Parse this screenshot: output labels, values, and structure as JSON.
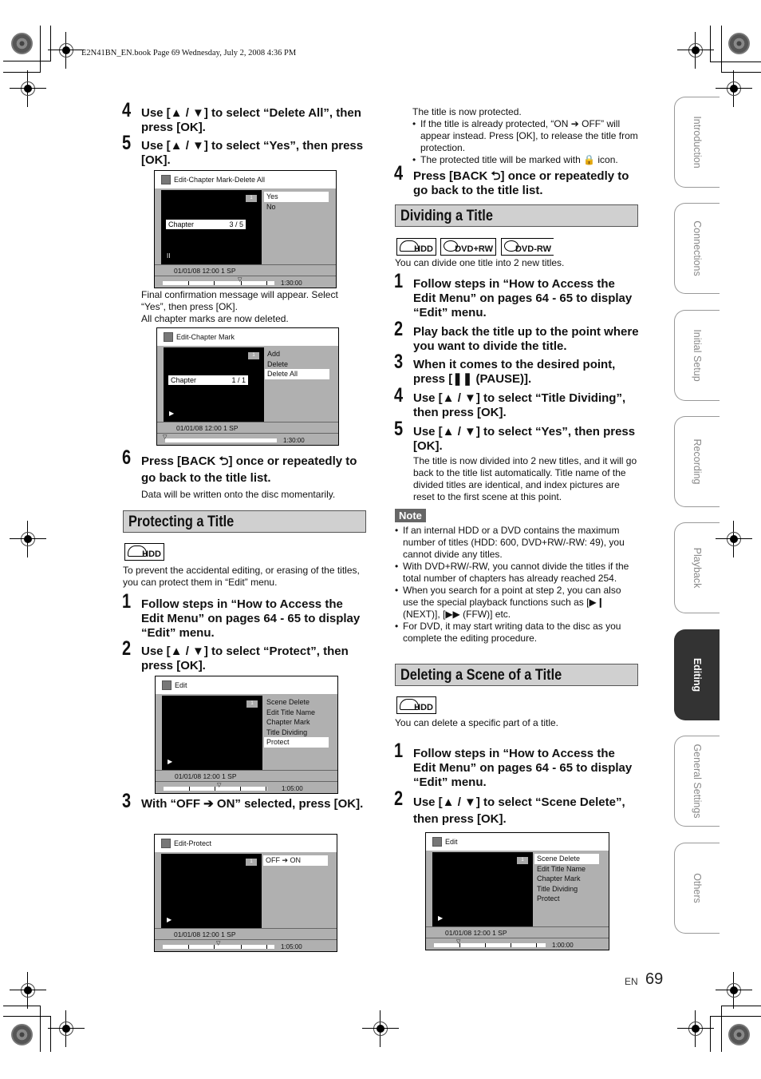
{
  "header": {
    "print_info": "E2N41BN_EN.book  Page 69  Wednesday, July 2, 2008  4:36 PM"
  },
  "left": {
    "step4": {
      "num": "4",
      "text": "Use [▲ / ▼] to select “Delete All”, then press [OK]."
    },
    "step5": {
      "num": "5",
      "text": "Use [▲ / ▼] to select “Yes”, then press [OK]."
    },
    "osd1": {
      "title": "Edit-Chapter Mark-Delete All",
      "title_no": "1",
      "chapter_label": "Chapter",
      "chapter_value": "3 / 5",
      "menu": [
        "Yes",
        "No"
      ],
      "status": "II",
      "info": "01/01/08  12:00   1 SP",
      "time": "1:30:00"
    },
    "after5": [
      "Final confirmation message will appear. Select “Yes”, then press [OK].",
      "All chapter marks are now deleted."
    ],
    "osd2": {
      "title": "Edit-Chapter Mark",
      "title_no": "1",
      "chapter_label": "Chapter",
      "chapter_value": "1 / 1",
      "menu": [
        "Add",
        "Delete",
        "Delete All"
      ],
      "status": "▶",
      "info": "01/01/08  12:00   1 SP",
      "time": "1:30:00"
    },
    "step6": {
      "num": "6",
      "text": "Press [BACK ⮌] once or repeatedly to go back to the title list."
    },
    "step6_note": "Data will be written onto the disc momentarily.",
    "protect": {
      "heading": "Protecting a Title",
      "media": [
        "HDD"
      ],
      "intro": "To prevent the accidental editing, or erasing of the titles, you can protect them in “Edit” menu.",
      "step1": {
        "num": "1",
        "text": "Follow steps in “How to Access the Edit Menu” on pages 64 - 65 to display “Edit” menu."
      },
      "step2": {
        "num": "2",
        "text": "Use [▲ / ▼] to select “Protect”, then press [OK]."
      },
      "osd3": {
        "title": "Edit",
        "title_no": "1",
        "menu": [
          "Scene Delete",
          "Edit Title Name",
          "Chapter Mark",
          "Title Dividing",
          "Protect"
        ],
        "status": "▶",
        "info": "01/01/08  12:00   1 SP",
        "time": "1:05:00"
      },
      "step3": {
        "num": "3",
        "text": "With “OFF ➔ ON” selected, press [OK]."
      },
      "osd4": {
        "title": "Edit-Protect",
        "title_no": "1",
        "menu": [
          "OFF ➔ ON"
        ],
        "status": "▶",
        "info": "01/01/08  12:00   1 SP",
        "time": "1:05:00"
      }
    }
  },
  "right": {
    "protected_text": "The title is now protected.",
    "protected_bullets": [
      "If the title is already protected, “ON ➔ OFF” will appear instead. Press [OK], to release the title from protection.",
      "The protected title will be marked with 🔒 icon."
    ],
    "step4": {
      "num": "4",
      "text": "Press [BACK ⮌] once or repeatedly to go back to the title list."
    },
    "divide": {
      "heading": "Dividing a Title",
      "media": [
        "HDD",
        "DVD+RW",
        "DVD-RW"
      ],
      "intro": "You can divide one title into 2 new titles.",
      "steps": [
        {
          "num": "1",
          "text": "Follow steps in “How to Access the Edit Menu” on pages 64 - 65 to display “Edit” menu."
        },
        {
          "num": "2",
          "text": "Play back the title up to the point where you want to divide the title."
        },
        {
          "num": "3",
          "text": "When it comes to the desired point, press [❚❚ (PAUSE)]."
        },
        {
          "num": "4",
          "text": "Use [▲ / ▼] to select “Title Dividing”, then press [OK]."
        },
        {
          "num": "5",
          "text": "Use [▲ / ▼] to select “Yes”, then press [OK]."
        }
      ],
      "after5": "The title is now divided into 2 new titles, and it will go back to the title list automatically. Title name of the divided titles are identical, and index pictures are reset to the first scene at this point.",
      "note_label": "Note",
      "notes": [
        "If an internal HDD or a DVD contains the maximum number of titles (HDD: 600, DVD+RW/-RW: 49), you cannot divide any titles.",
        "With DVD+RW/-RW, you cannot divide the titles if the total number of chapters has already reached 254.",
        "When you search for a point at step 2, you can also use the special playback functions such as [▶❙ (NEXT)], [▶▶ (FFW)] etc.",
        "For DVD, it may start writing data to the disc as you complete the editing procedure."
      ]
    },
    "scene": {
      "heading": "Deleting a Scene of a Title",
      "media": [
        "HDD"
      ],
      "intro": "You can delete a specific part of a title.",
      "step1": {
        "num": "1",
        "text": "Follow steps in “How to Access the Edit Menu” on pages 64 - 65 to display “Edit” menu."
      },
      "step2": {
        "num": "2",
        "text": "Use [▲ / ▼] to select “Scene Delete”, then press [OK]."
      },
      "osd5": {
        "title": "Edit",
        "title_no": "1",
        "menu": [
          "Scene Delete",
          "Edit Title Name",
          "Chapter Mark",
          "Title Dividing",
          "Protect"
        ],
        "status": "▶",
        "info": "01/01/08  12:00   1 SP",
        "time": "1:00:00"
      }
    }
  },
  "side_tabs": [
    "Introduction",
    "Connections",
    "Initial Setup",
    "Recording",
    "Playback",
    "Editing",
    "General Settings",
    "Others"
  ],
  "active_tab": "Editing",
  "footer": {
    "lang": "EN",
    "page": "69"
  }
}
